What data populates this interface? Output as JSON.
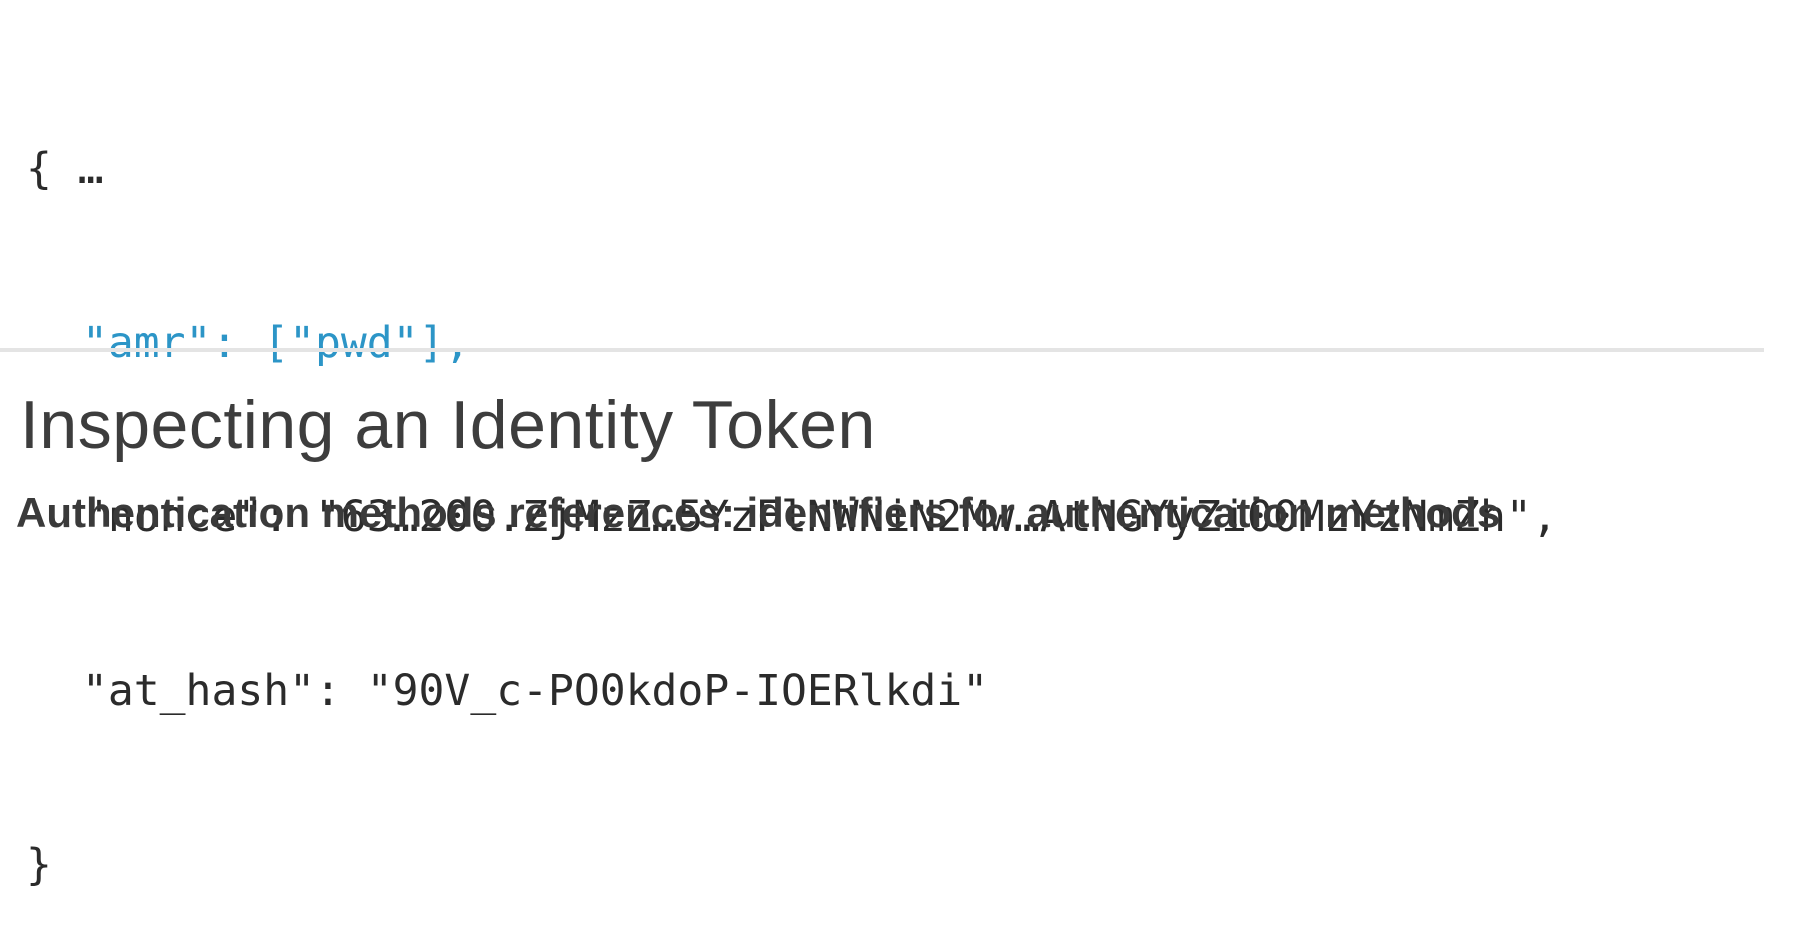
{
  "code": {
    "open": "{ …",
    "amr_line": "\"amr\": [\"pwd\"],",
    "nonce_line": "\"nonce\": \"63…200.ZjMzZ…5YzFlNWNiN2Mw…AtNGYyZi00MzYzNmZh\",",
    "at_hash_line": "\"at_hash\": \"90V_c-PO0kdoP-IOERlkdi\"",
    "close": "}"
  },
  "title": "Inspecting an Identity Token",
  "subtitle": "Authentication methods references: identifiers for authentication methods",
  "colors": {
    "highlight": "#2c95c7",
    "text": "#2b2b2b",
    "divider": "#e4e4e4"
  }
}
